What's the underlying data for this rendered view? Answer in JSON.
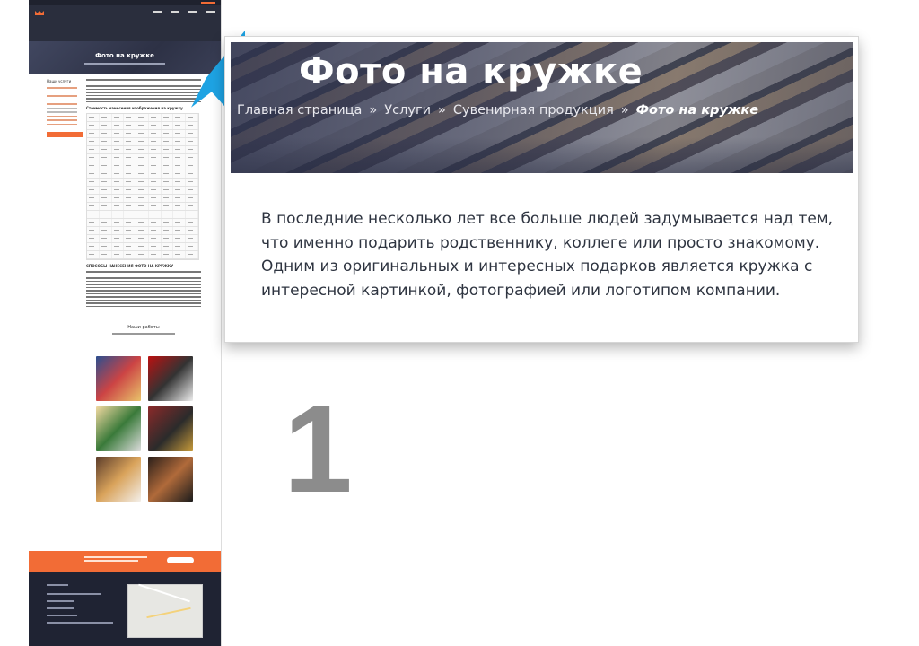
{
  "page": {
    "hero_title": "Фото на кружке",
    "breadcrumb": {
      "home": "Главная страница",
      "services": "Услуги",
      "category": "Сувенирная продукция",
      "current": "Фото на кружке",
      "separator": "»"
    },
    "intro_text": "В последние несколько лет все больше людей задумывается над тем, что именно подарить родственнику, коллеге или просто знакомому. Одним из оригинальных и интересных подарков является кружка с интересной картинкой, фотографией или логотипом компании."
  },
  "thumbnail": {
    "hero_title": "Фото на кружке",
    "sidebar_title": "Наши услуги",
    "table_title": "Стоимость нанесения изображения на кружку",
    "methods_title": "СПОСОБЫ НАНЕСЕНИЯ ФОТО НА КРУЖКУ",
    "works_title": "Наши работы"
  },
  "annotation": {
    "step_number": "1",
    "pointer_color": "#1ea3e3"
  },
  "colors": {
    "accent": "#f26c36",
    "header_dark": "#2a2e3d",
    "footer_dark": "#1f2333"
  }
}
